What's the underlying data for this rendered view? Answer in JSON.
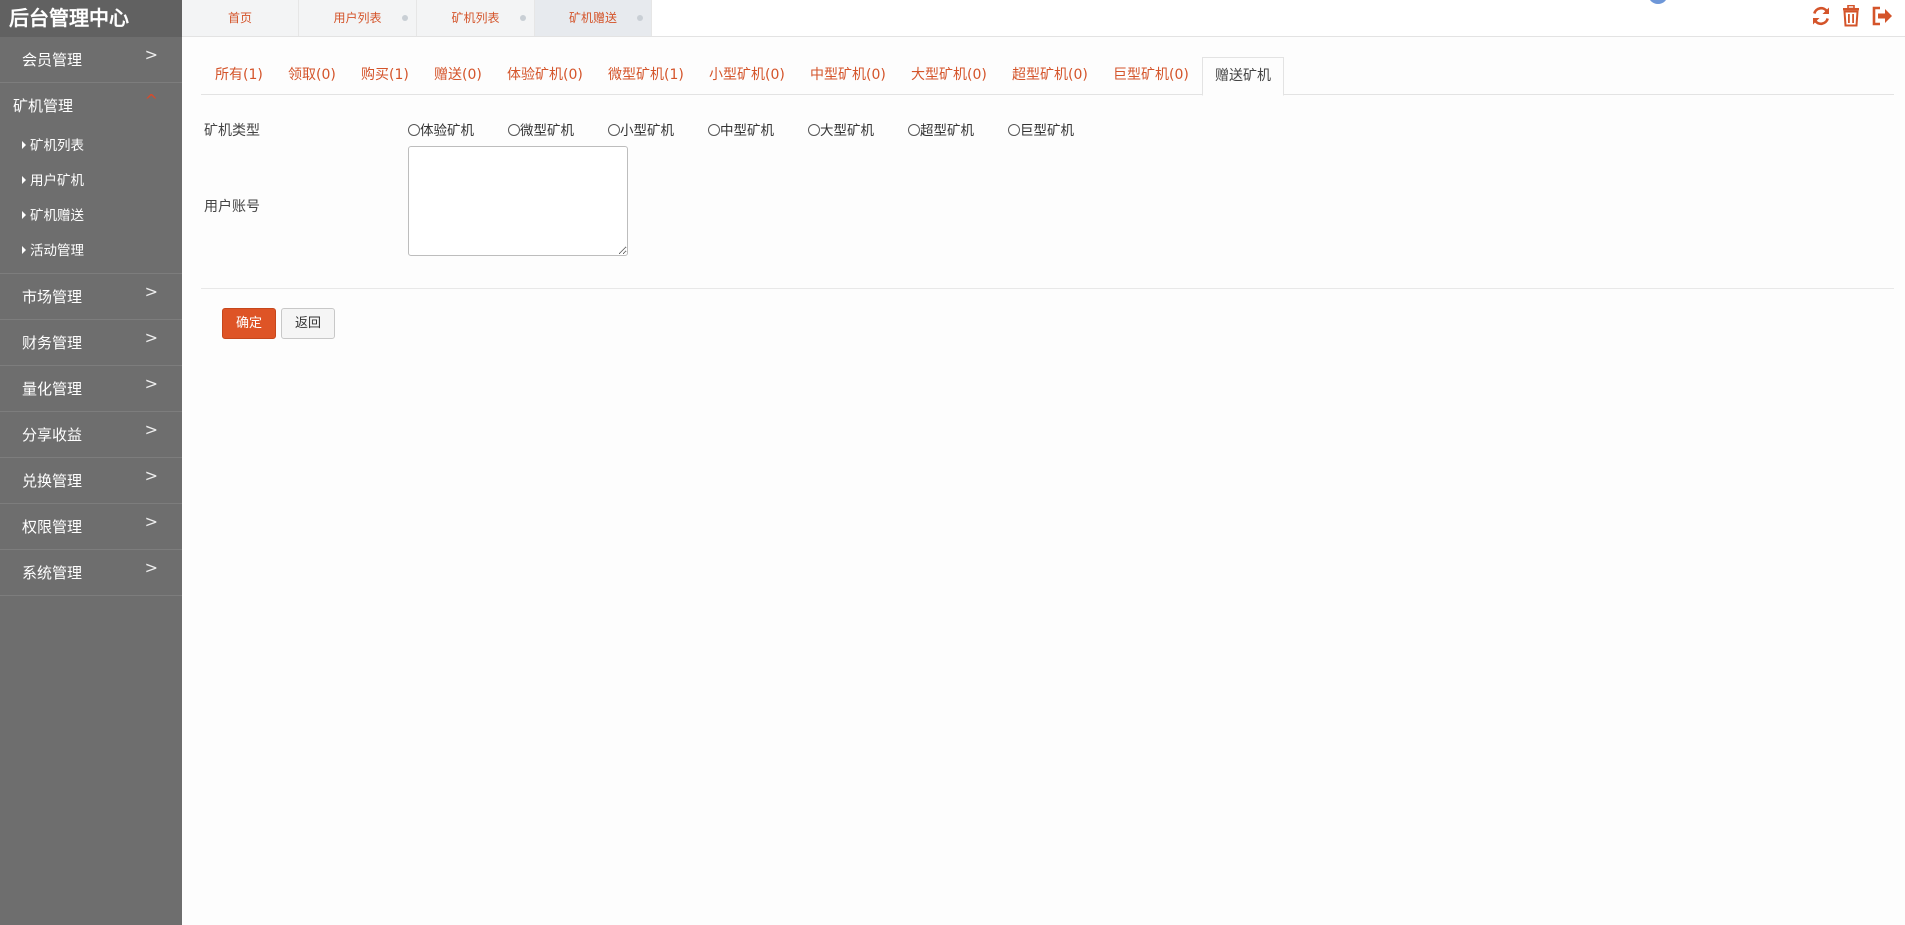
{
  "sidebar": {
    "brand": "后台管理中心",
    "menu": [
      {
        "label": "会员管理",
        "chevron": ">"
      },
      {
        "label": "矿机管理",
        "chevron": "^",
        "open": true,
        "children": [
          "矿机列表",
          "用户矿机",
          "矿机赠送",
          "活动管理"
        ]
      },
      {
        "label": "市场管理",
        "chevron": ">"
      },
      {
        "label": "财务管理",
        "chevron": ">"
      },
      {
        "label": "量化管理",
        "chevron": ">"
      },
      {
        "label": "分享收益",
        "chevron": ">"
      },
      {
        "label": "兑换管理",
        "chevron": ">"
      },
      {
        "label": "权限管理",
        "chevron": ">"
      },
      {
        "label": "系统管理",
        "chevron": ">"
      }
    ]
  },
  "topbar": {
    "tabs": [
      "首页",
      "用户列表",
      "矿机列表",
      "矿机赠送"
    ],
    "active_tab": 3,
    "tools": [
      "refresh-icon",
      "trash-icon",
      "logout-icon"
    ],
    "accent": "#d4542a"
  },
  "subtabs": [
    "所有(1)",
    "领取(0)",
    "购买(1)",
    "赠送(0)",
    "体验矿机(0)",
    "微型矿机(1)",
    "小型矿机(0)",
    "中型矿机(0)",
    "大型矿机(0)",
    "超型矿机(0)",
    "巨型矿机(0)",
    "赠送矿机"
  ],
  "active_subtab": 11,
  "form": {
    "type_label": "矿机类型",
    "type_options": [
      "体验矿机",
      "微型矿机",
      "小型矿机",
      "中型矿机",
      "大型矿机",
      "超型矿机",
      "巨型矿机"
    ],
    "account_label": "用户账号",
    "account_value": ""
  },
  "buttons": {
    "confirm": "确定",
    "back": "返回"
  }
}
